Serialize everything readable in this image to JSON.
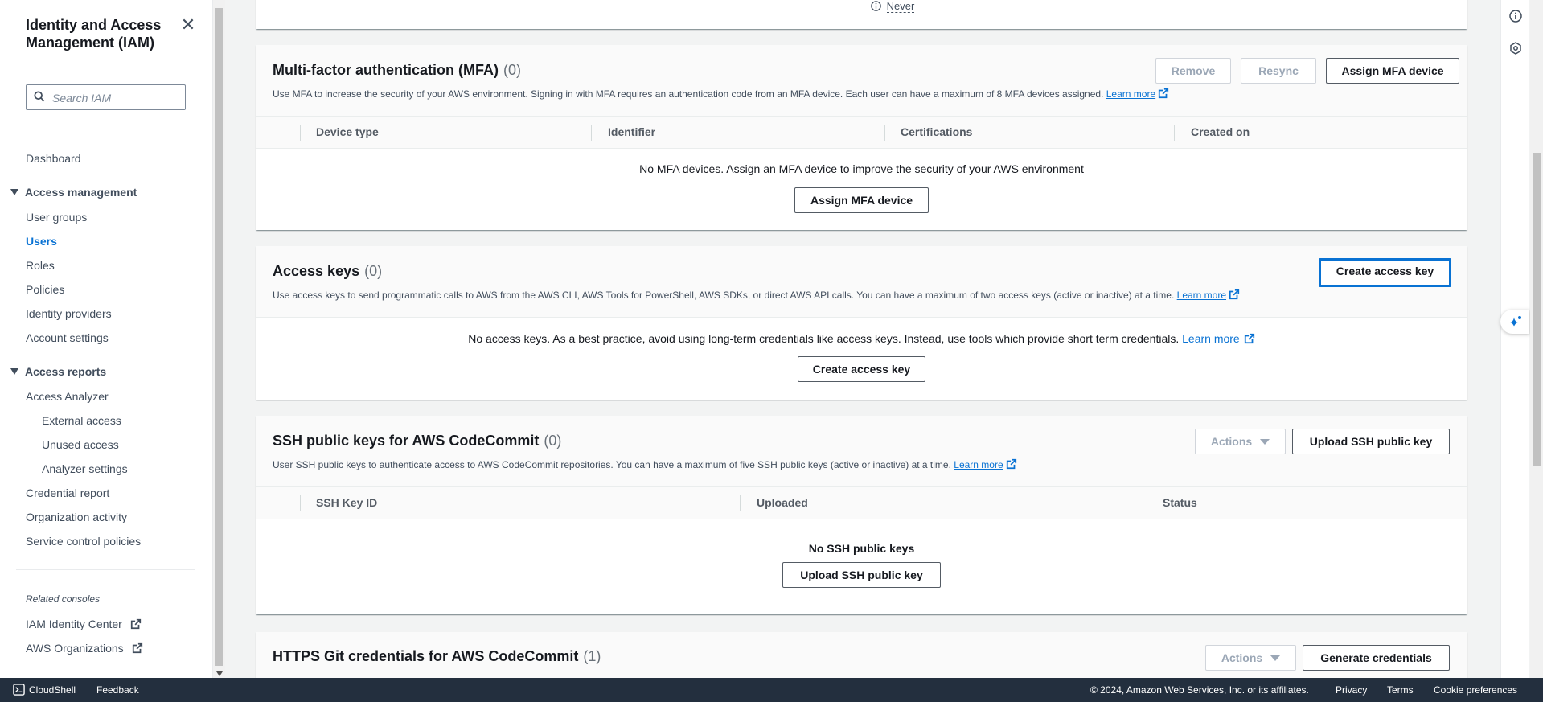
{
  "sidebar": {
    "title": "Identity and Access Management (IAM)",
    "search_placeholder": "Search IAM",
    "dashboard": "Dashboard",
    "access_management": {
      "label": "Access management",
      "items": [
        "User groups",
        "Users",
        "Roles",
        "Policies",
        "Identity providers",
        "Account settings"
      ]
    },
    "access_reports": {
      "label": "Access reports",
      "analyzer": "Access Analyzer",
      "analyzer_items": [
        "External access",
        "Unused access",
        "Analyzer settings"
      ],
      "items": [
        "Credential report",
        "Organization activity",
        "Service control policies"
      ]
    },
    "related_label": "Related consoles",
    "related": [
      "IAM Identity Center",
      "AWS Organizations"
    ]
  },
  "top_fragment": {
    "never_text": "Never"
  },
  "mfa": {
    "title": "Multi-factor authentication (MFA)",
    "count": "(0)",
    "description": "Use MFA to increase the security of your AWS environment. Signing in with MFA requires an authentication code from an MFA device. Each user can have a maximum of 8 MFA devices assigned.",
    "learn_more": "Learn more",
    "buttons": {
      "remove": "Remove",
      "resync": "Resync",
      "assign": "Assign MFA device"
    },
    "columns": [
      "Device type",
      "Identifier",
      "Certifications",
      "Created on"
    ],
    "empty_text": "No MFA devices. Assign an MFA device to improve the security of your AWS environment",
    "empty_button": "Assign MFA device"
  },
  "access_keys": {
    "title": "Access keys",
    "count": "(0)",
    "description": "Use access keys to send programmatic calls to AWS from the AWS CLI, AWS Tools for PowerShell, AWS SDKs, or direct AWS API calls. You can have a maximum of two access keys (active or inactive) at a time.",
    "learn_more": "Learn more",
    "create_button": "Create access key",
    "empty_text": "No access keys. As a best practice, avoid using long-term credentials like access keys. Instead, use tools which provide short term credentials.",
    "empty_learn_more": "Learn more",
    "empty_button": "Create access key"
  },
  "ssh": {
    "title": "SSH public keys for AWS CodeCommit",
    "count": "(0)",
    "description": "User SSH public keys to authenticate access to AWS CodeCommit repositories. You can have a maximum of five SSH public keys (active or inactive) at a time.",
    "learn_more": "Learn more",
    "actions": "Actions",
    "upload": "Upload SSH public key",
    "columns": [
      "SSH Key ID",
      "Uploaded",
      "Status"
    ],
    "empty_text": "No SSH public keys",
    "empty_button": "Upload SSH public key"
  },
  "https_git": {
    "title": "HTTPS Git credentials for AWS CodeCommit",
    "count": "(1)",
    "actions": "Actions",
    "generate": "Generate credentials"
  },
  "footer": {
    "cloudshell": "CloudShell",
    "feedback": "Feedback",
    "copyright": "© 2024, Amazon Web Services, Inc. or its affiliates.",
    "privacy": "Privacy",
    "terms": "Terms",
    "cookie": "Cookie preferences"
  }
}
